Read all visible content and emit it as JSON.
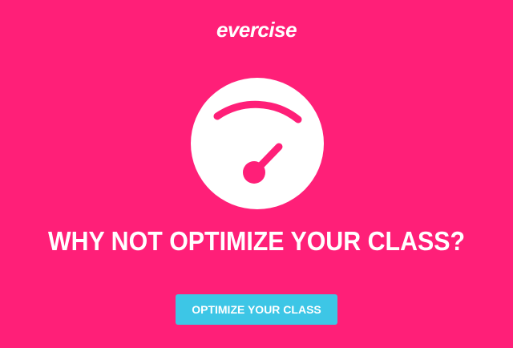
{
  "brand": {
    "logo_text": "evercise",
    "background_color": "#ff1f78",
    "accent_color": "#3dc6e6"
  },
  "hero": {
    "icon": "speedometer-icon",
    "headline": "WHY NOT OPTIMIZE YOUR CLASS?"
  },
  "cta": {
    "label": "OPTIMIZE YOUR CLASS"
  }
}
